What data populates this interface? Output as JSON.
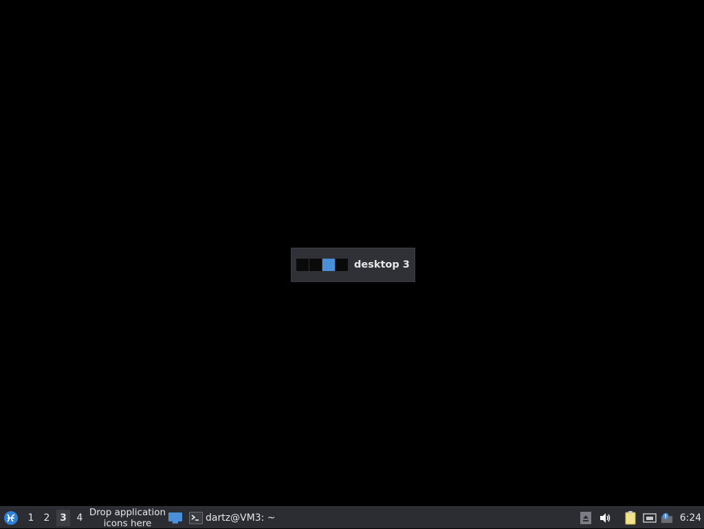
{
  "osd": {
    "label": "desktop 3",
    "desktop_count": 4,
    "active_desktop": 3,
    "active_color": "#4a90d9"
  },
  "taskbar": {
    "start_icon": "lxqt-logo-icon",
    "workspaces": [
      {
        "label": "1",
        "active": false
      },
      {
        "label": "2",
        "active": false
      },
      {
        "label": "3",
        "active": true
      },
      {
        "label": "4",
        "active": false
      }
    ],
    "launcher_line1": "Drop application",
    "launcher_line2": "icons here",
    "show_desktop_icon": "show-desktop-icon",
    "task": {
      "icon": "terminal-icon",
      "label": "dartz@VM3: ~"
    },
    "tray": {
      "icons": [
        "eject-icon",
        "volume-icon",
        "clipboard-icon",
        "network-icon",
        "update-notifier-icon"
      ]
    },
    "clock": "6:24"
  }
}
